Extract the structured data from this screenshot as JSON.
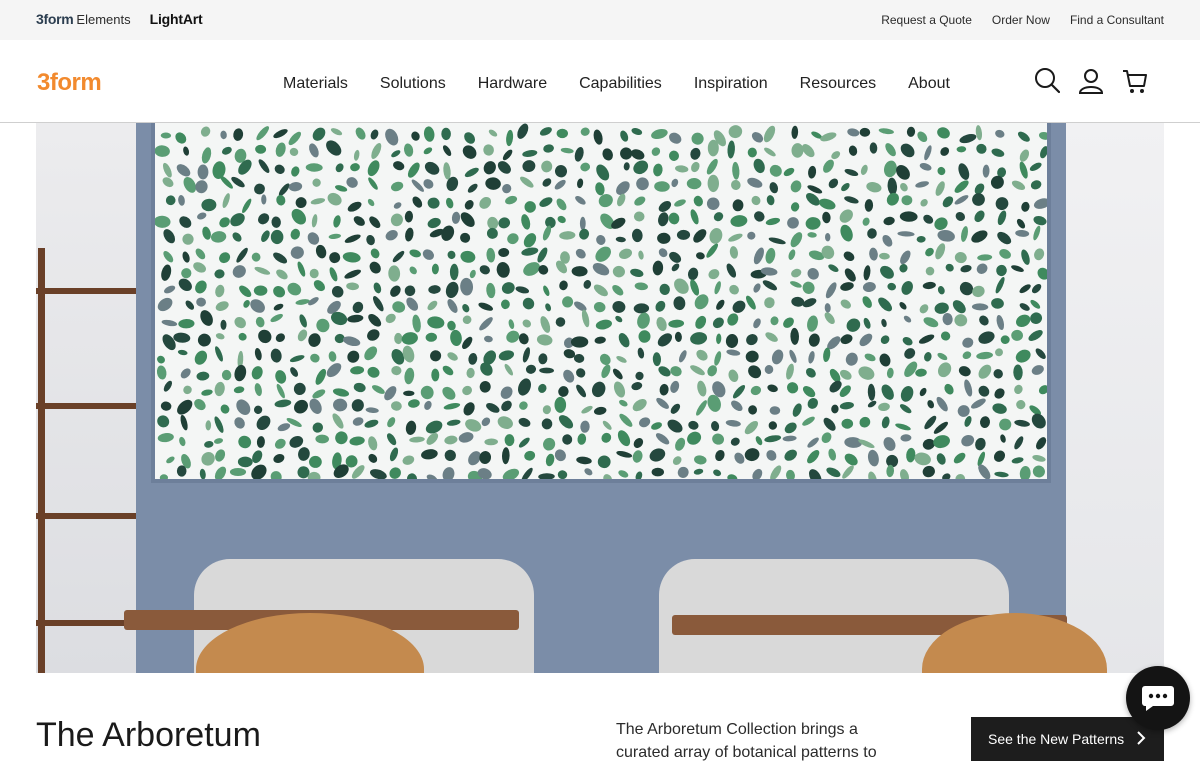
{
  "utility_bar": {
    "brand_3form": "3form",
    "brand_elements": "Elements",
    "brand_lightart": "LightArt",
    "links": [
      "Request a Quote",
      "Order Now",
      "Find a Consultant"
    ]
  },
  "header": {
    "logo": "3form",
    "nav": [
      "Materials",
      "Solutions",
      "Hardware",
      "Capabilities",
      "Inspiration",
      "Resources",
      "About"
    ],
    "icons": [
      "search-icon",
      "account-icon",
      "cart-icon"
    ]
  },
  "hero": {
    "alt_subject": "botanical pattern wall panel"
  },
  "intro": {
    "title": "The Arboretum",
    "text": "The Arboretum Collection brings a curated array of botanical patterns to",
    "cta": "See the New Patterns"
  },
  "colors": {
    "brand_orange": "#f28a2e",
    "cta_bg": "#1d1d1d",
    "partition_blue": "#7b8da8"
  }
}
